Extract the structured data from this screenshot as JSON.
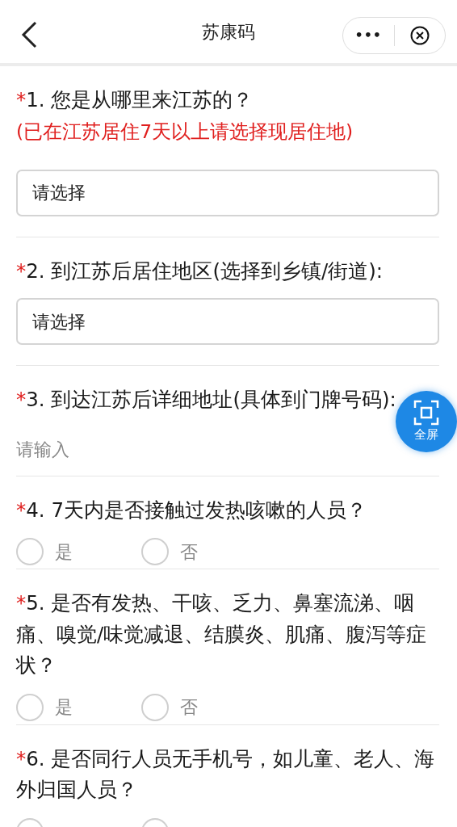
{
  "header": {
    "title": "苏康码",
    "more": "•••"
  },
  "questions": [
    {
      "kind": "select",
      "mark": "*",
      "label": "1. 您是从哪里来江苏的？",
      "note": "(已在江苏居住7天以上请选择现居住地)",
      "placeholder": "请选择"
    },
    {
      "kind": "select",
      "mark": "*",
      "label": "2. 到江苏后居住地区(选择到乡镇/街道):",
      "placeholder": "请选择"
    },
    {
      "kind": "input",
      "mark": "*",
      "label": "3. 到达江苏后详细地址(具体到门牌号码):",
      "placeholder": "请输入"
    },
    {
      "kind": "radio",
      "mark": "*",
      "label": "4. 7天内是否接触过发热咳嗽的人员？",
      "options": [
        {
          "label": "是",
          "selected": false
        },
        {
          "label": "否",
          "selected": false
        }
      ]
    },
    {
      "kind": "radio",
      "mark": "*",
      "label": "5. 是否有发热、干咳、乏力、鼻塞流涕、咽痛、嗅觉/味觉减退、结膜炎、肌痛、腹泻等症状？",
      "options": [
        {
          "label": "是",
          "selected": false
        },
        {
          "label": "否",
          "selected": false
        }
      ]
    },
    {
      "kind": "radio",
      "mark": "*",
      "label": "6. 是否同行人员无手机号，如儿童、老人、海外归国人员？",
      "options": [
        {
          "selected": false
        },
        {
          "selected": false
        }
      ]
    }
  ],
  "fullscreen_button": {
    "label": "全屏"
  }
}
